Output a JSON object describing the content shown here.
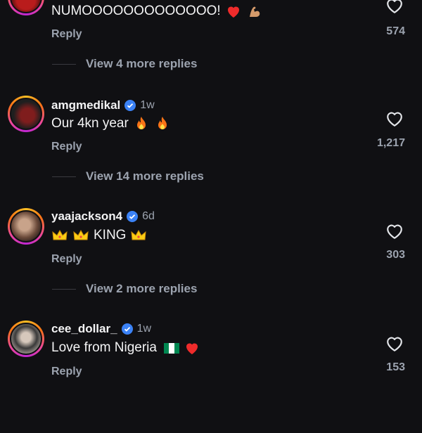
{
  "comments": [
    {
      "username": "",
      "time": "",
      "text": "NUMOOOOOOOOOOOOO!",
      "reply": "Reply",
      "likes": "574",
      "view_replies": "View 4 more replies"
    },
    {
      "username": "amgmedikal",
      "time": "1w",
      "text": "Our 4kn year",
      "reply": "Reply",
      "likes": "1,217",
      "view_replies": "View 14 more replies"
    },
    {
      "username": "yaajackson4",
      "time": "6d",
      "text": "KING",
      "reply": "Reply",
      "likes": "303",
      "view_replies": "View 2 more replies"
    },
    {
      "username": "cee_dollar_",
      "time": "1w",
      "text": "Love from Nigeria",
      "reply": "Reply",
      "likes": "153",
      "view_replies": ""
    }
  ],
  "icons": {
    "like": "heart-outline-icon",
    "verified": "verified-badge-icon"
  },
  "colors": {
    "background": "#101013",
    "verified": "#3b82f6",
    "muted": "#9ca3af"
  }
}
